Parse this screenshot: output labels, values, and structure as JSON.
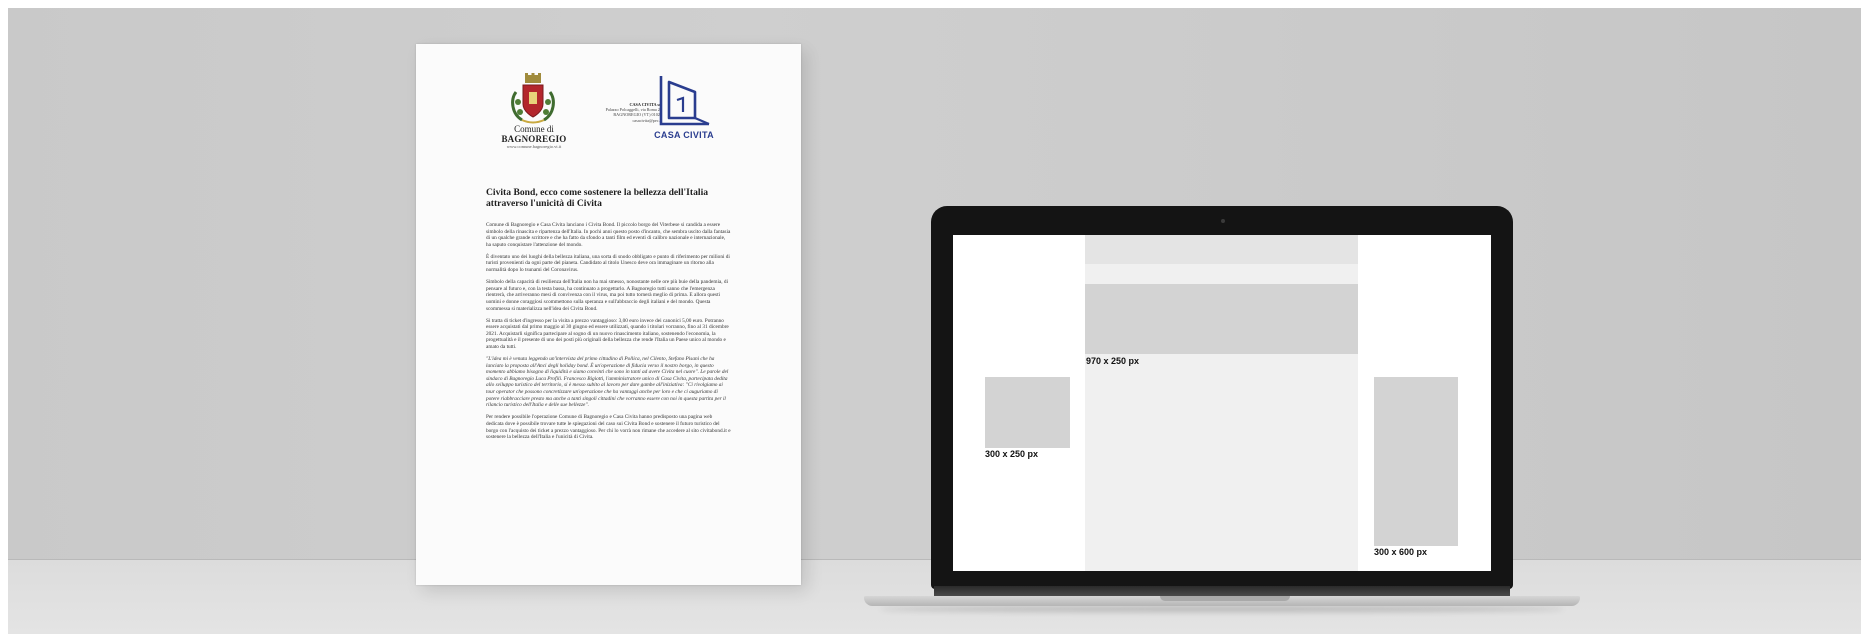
{
  "document": {
    "comune": {
      "line1": "Comune di",
      "line2": "BAGNOREGIO",
      "website": "www.comune.bagnoregio.vt.it"
    },
    "casa_civita": {
      "address_name": "CASA CIVITA srl",
      "address_line1": "Palazzo Polcaggelli, via Roma 28",
      "address_line2": "BAGNOREGIO (VT) 01022",
      "address_line3": "casacivita@pec.it",
      "logo_text": "CASA CIVITA"
    },
    "title": "Civita Bond, ecco come sostenere la bellezza dell'Italia attraverso l'unicità di Civita",
    "paragraphs": [
      "Comune di Bagnoregio e Casa Civita lanciano i Civita Bond. Il piccolo borgo del Viterbese si candida a essere simbolo della rinascita e ripartenza dell'Italia. In pochi anni questo posto d'incanto, che sembra uscito dalla fantasia di un qualche grande scrittore e che ha fatto da sfondo a tanti film ed eventi di calibro nazionale e internazionale, ha saputo conquistare l'attenzione del mondo.",
      "È diventato uno dei luoghi della bellezza italiana, una sorta di snodo obbligato e punto di riferimento per milioni di turisti provenienti da ogni parte del pianeta. Candidato al titolo Unesco deve ora immaginare un ritorno alla normalità dopo lo tsunami del Coronavirus.",
      "Simbolo della capacità di resilienza dell'Italia non ha mai smesso, nonostante nelle ore più buie della pandemia, di pensare al futuro e, con la testa bassa, ha continuato a progettarlo. A Bagnoregio tutti sanno che l'emergenza rientrerà, che arriveranno mesi di convivenza con il virus, ma poi tutto tornerà meglio di prima. E allora questi uomini e donne coraggiosi scommettono sulla speranza e sull'abbraccio degli italiani e del mondo. Questa scommessa si materializza nell'idea dei Civita Bond.",
      "Si tratta di ticket d'ingresso per la visita a prezzo vantaggioso: 3,00 euro invece dei canonici 5,00 euro. Potranno essere acquistati dal primo maggio al 30 giugno ed essere utilizzati, quando i titolari vorranno, fino al 31 dicembre 2021. Acquistarli significa partecipare al sogno di un nuovo rinascimento italiano, sostenendo l'economia, la progettualità e il presente di uno dei posti più originali della bellezza che rende l'Italia un Paese unico al mondo e amato da tutti.",
      "\"L'idea mi è venuta leggendo un'intervista del primo cittadino di Pollica, nel Cilento, Stefano Pisani che ha lanciato la proposta all'Anci degli holiday bond. È un'operazione di fiducia verso il nostro borgo, in questo momento abbiamo bisogno di liquidità e siamo convinti che sono in tanti ad avere Civita nel cuore\". Le parole del sindaco di Bagnoregio Luca Profili. Francesco Bigiotti, l'amministratore unico di Casa Civita, partecipata dedita allo sviluppo turistico del territorio, si è messo subito al lavoro per dare gambe all'iniziativa: \"Ci rivolgiamo ai tour operator che possono concretizzare un'operazione che ha vantaggi anche per loro e che ci auguriamo di potere riabbracciare presto ma anche a tanti singoli cittadini che vorranno essere con noi in questa partita per il rilancio turistico dell'Italia e delle sue bellezze\".",
      "Per rendere possibile l'operazione Comune di Bagnoregio e Casa Civita hanno predisposto una pagina web dedicata dove è possibile trovare tutte le spiegazioni del caso sui Civita Bond e sostenere il futuro turistico del borgo con l'acquisto dei ticket a prezzo vantaggioso. Per chi lo vorrà non rimane che accedere al sito civitabond.it e sostenere la bellezza dell'Italia e l'unicità di Civita."
    ]
  },
  "laptop_screen": {
    "leaderboard_label": "970 x 250 px",
    "rectangle_label": "300 x 250 px",
    "half_page_label": "300 x 600 px"
  },
  "colors": {
    "casa_civita_blue": "#2a3d8f",
    "ad_placeholder": "#d3d3d3",
    "center_column": "#f0f0f0"
  }
}
